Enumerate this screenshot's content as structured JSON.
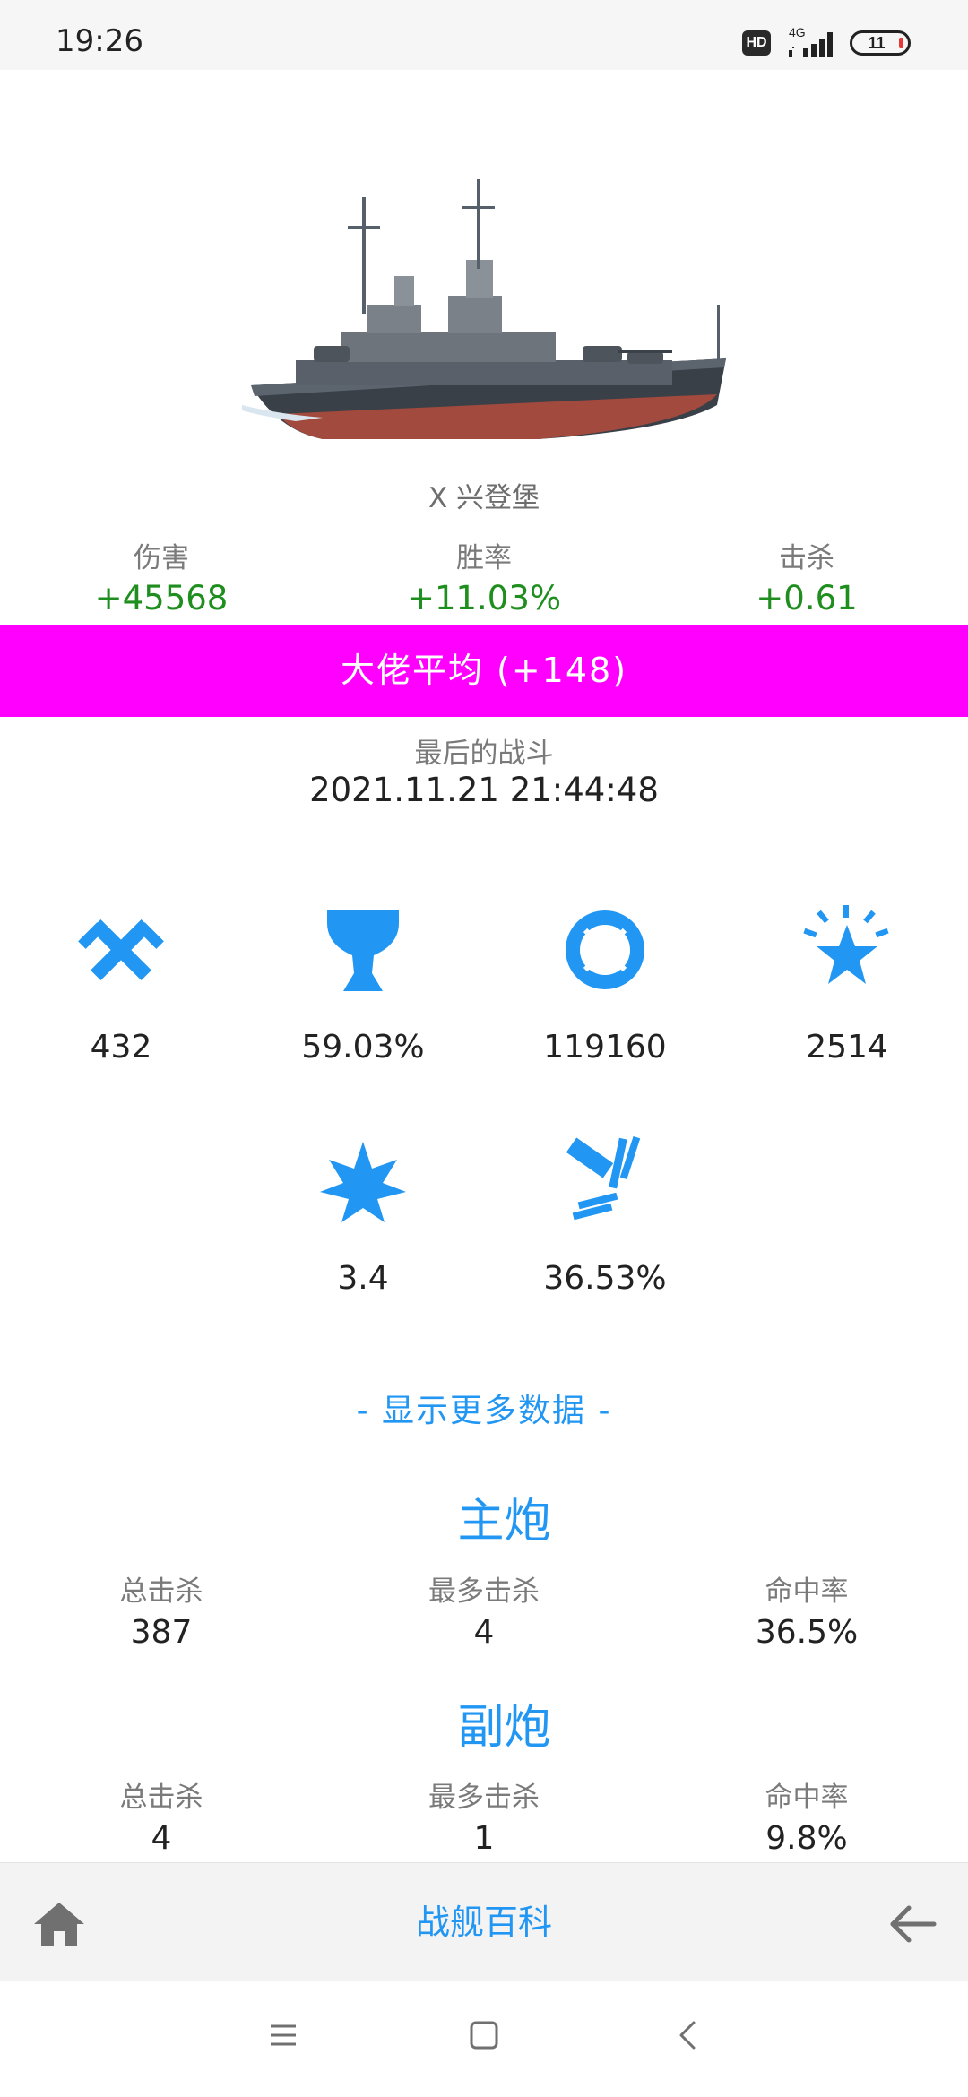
{
  "status_bar": {
    "time": "19:26",
    "hd_label": "HD",
    "network": "4G",
    "battery_level": "11",
    "icons": [
      "hd-icon",
      "signal-icon",
      "battery-icon"
    ]
  },
  "ship": {
    "name": "X 兴登堡",
    "image_icon": "battleship-image"
  },
  "deltas": {
    "damage_label": "伤害",
    "damage_value": "+45568",
    "winrate_label": "胜率",
    "winrate_value": "+11.03%",
    "kills_label": "击杀",
    "kills_value": "+0.61",
    "positive_color": "#1e8e1e"
  },
  "rating": {
    "text": "大佬平均 (+148)",
    "color": "#ff00ff"
  },
  "last_battle": {
    "label": "最后的战斗",
    "time": "2021.11.21 21:44:48"
  },
  "icon_stats": [
    {
      "icon": "crossed-swords-icon",
      "value": "432"
    },
    {
      "icon": "trophy-icon",
      "value": "59.03%"
    },
    {
      "icon": "lifebuoy-icon",
      "value": "119160"
    },
    {
      "icon": "star-burst-icon",
      "value": "2514"
    },
    {
      "icon": "explosion-icon",
      "value": "3.4"
    },
    {
      "icon": "shell-hit-icon",
      "value": "36.53%"
    }
  ],
  "more_data_link": "- 显示更多数据 -",
  "main_battery": {
    "title": "主炮",
    "total_kills_label": "总击杀",
    "total_kills": "387",
    "max_kills_label": "最多击杀",
    "max_kills": "4",
    "hit_rate_label": "命中率",
    "hit_rate": "36.5%"
  },
  "secondary_battery": {
    "title": "副炮",
    "total_kills_label": "总击杀",
    "total_kills": "4",
    "max_kills_label": "最多击杀",
    "max_kills": "1",
    "hit_rate_label": "命中率",
    "hit_rate": "9.8%"
  },
  "bottom_nav": {
    "title": "战舰百科",
    "home_icon": "home-icon",
    "back_icon": "arrow-left-icon"
  },
  "system_nav": {
    "icons": [
      "menu-icon",
      "home-square-icon",
      "back-chevron-icon"
    ]
  },
  "accent_color": "#2196f3"
}
